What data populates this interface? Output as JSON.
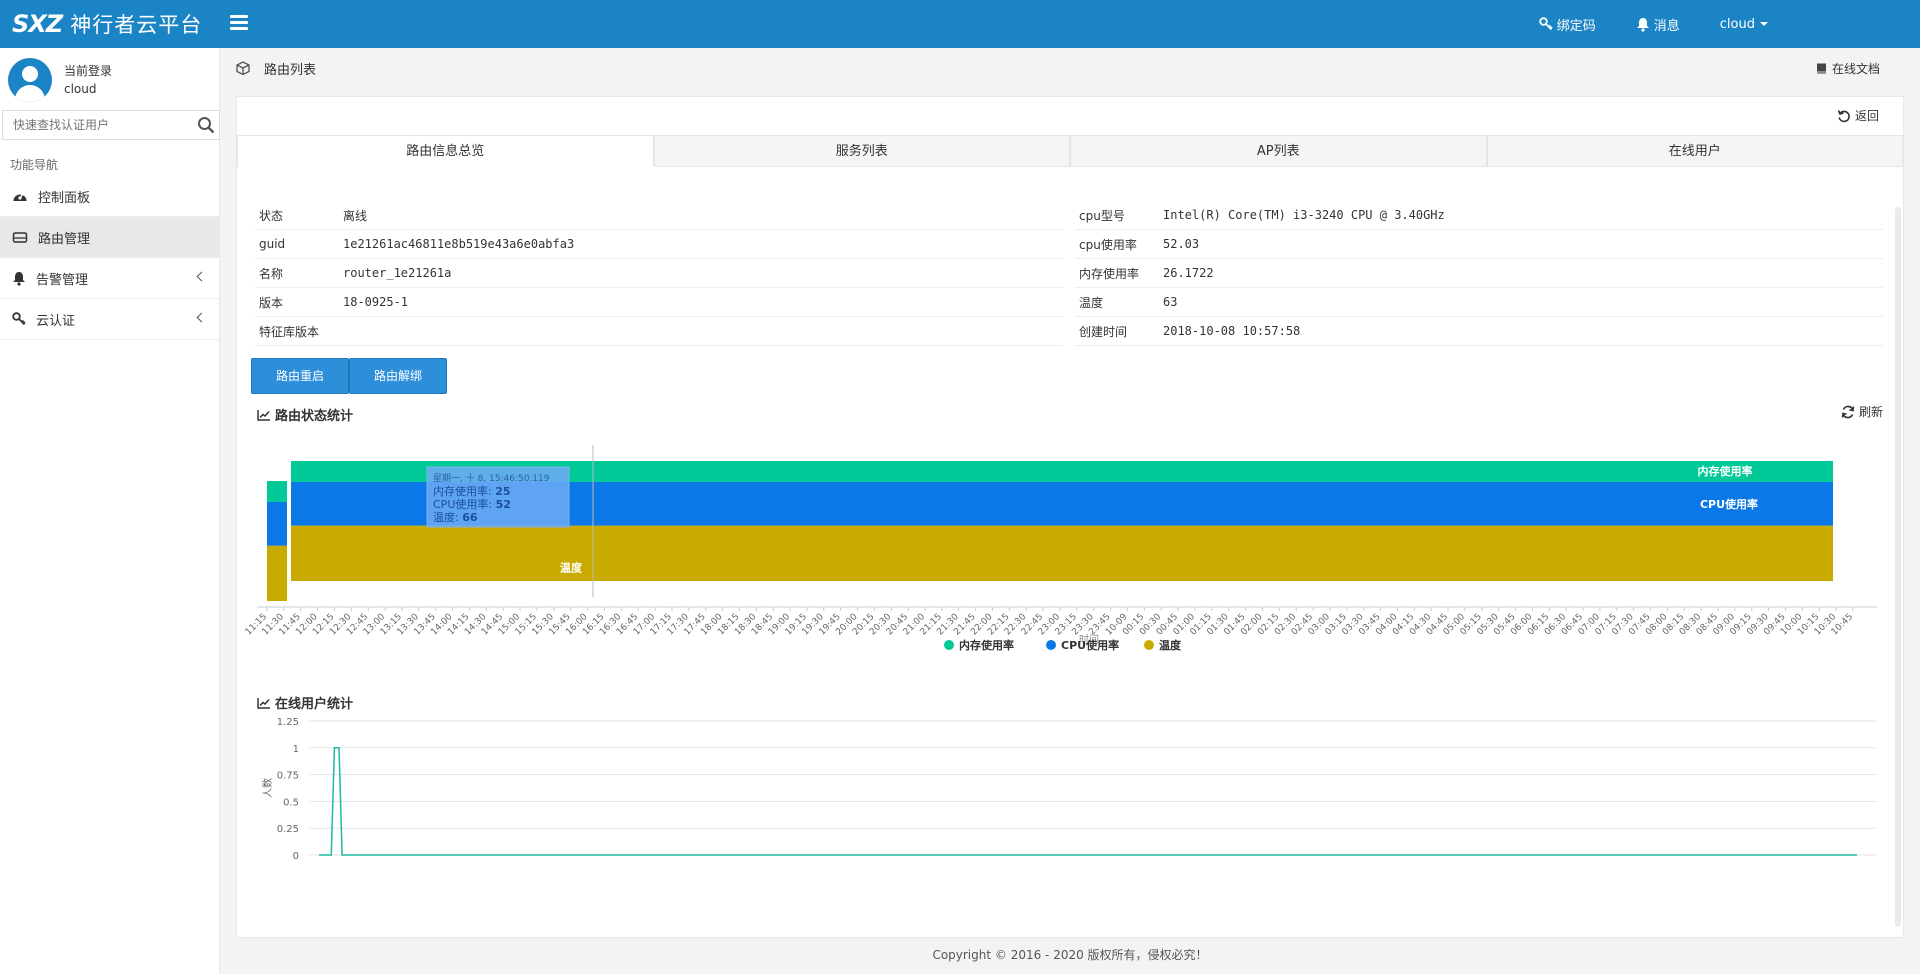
{
  "header": {
    "logo_mark": "SXZ",
    "logo_text": "神行者云平台",
    "bind_code": "绑定码",
    "messages": "消息",
    "user": "cloud"
  },
  "sidebar": {
    "login_label": "当前登录",
    "username": "cloud",
    "search_placeholder": "快速查找认证用户",
    "nav_header": "功能导航",
    "items": [
      {
        "label": "控制面板",
        "icon": "dashboard-icon"
      },
      {
        "label": "路由管理",
        "icon": "router-icon",
        "active": true
      },
      {
        "label": "告警管理",
        "icon": "bell-icon"
      },
      {
        "label": "云认证",
        "icon": "key-icon"
      }
    ]
  },
  "breadcrumb": {
    "title": "路由列表",
    "doc_link": "在线文档"
  },
  "panel": {
    "back_label": "返回",
    "tabs": [
      "路由信息总览",
      "服务列表",
      "AP列表",
      "在线用户"
    ],
    "info_left": [
      {
        "key": "状态",
        "value": "离线"
      },
      {
        "key": "guid",
        "value": "1e21261ac46811e8b519e43a6e0abfa3"
      },
      {
        "key": "名称",
        "value": "router_1e21261a"
      },
      {
        "key": "版本",
        "value": "18-0925-1"
      },
      {
        "key": "特征库版本",
        "value": ""
      }
    ],
    "info_right": [
      {
        "key": "cpu型号",
        "value": "Intel(R) Core(TM) i3-3240 CPU @ 3.40GHz"
      },
      {
        "key": "cpu使用率",
        "value": "52.03"
      },
      {
        "key": "内存使用率",
        "value": "26.1722"
      },
      {
        "key": "温度",
        "value": "63"
      },
      {
        "key": "创建时间",
        "value": "2018-10-08 10:57:58"
      }
    ],
    "restart_button": "路由重启",
    "unbind_button": "路由解绑",
    "status_title": "路由状态统计",
    "refresh_label": "刷新",
    "users_title": "在线用户统计"
  },
  "chart_data": [
    {
      "type": "area",
      "title": "路由状态统计",
      "stacked": true,
      "categories": [
        "11:15",
        "11:30",
        "11:45",
        "12:00",
        "12:15",
        "12:30",
        "12:45",
        "13:00",
        "13:15",
        "13:30",
        "13:45",
        "14:00",
        "14:15",
        "14:30",
        "14:45",
        "15:00",
        "15:15",
        "15:30",
        "15:45",
        "16:00",
        "16:15",
        "16:30",
        "16:45",
        "17:00",
        "17:15",
        "17:30",
        "17:45",
        "18:00",
        "18:15",
        "18:30",
        "18:45",
        "19:00",
        "19:15",
        "19:30",
        "19:45",
        "20:00",
        "20:15",
        "20:30",
        "20:45",
        "21:00",
        "21:15",
        "21:30",
        "21:45",
        "22:00",
        "22:15",
        "22:30",
        "22:45",
        "23:00",
        "23:15",
        "23:30",
        "23:45",
        "10-09",
        "00:15",
        "00:30",
        "00:45",
        "01:00",
        "01:15",
        "01:30",
        "01:45",
        "02:00",
        "02:15",
        "02:30",
        "02:45",
        "03:00",
        "03:15",
        "03:30",
        "03:45",
        "04:00",
        "04:15",
        "04:30",
        "04:45",
        "05:00",
        "05:15",
        "05:30",
        "05:45",
        "06:00",
        "06:15",
        "06:30",
        "06:45",
        "07:00",
        "07:15",
        "07:30",
        "07:45",
        "08:00",
        "08:15",
        "08:30",
        "08:45",
        "09:00",
        "09:15",
        "09:30",
        "09:45",
        "10:00",
        "10:15",
        "10:30",
        "10:45"
      ],
      "series": [
        {
          "name": "温度",
          "color": "#c9ab00",
          "value": 66
        },
        {
          "name": "CPU使用率",
          "color": "#0a78e6",
          "value": 52
        },
        {
          "name": "内存使用率",
          "color": "#00c997",
          "value": 25
        }
      ],
      "tooltip": {
        "time": "星期一, 十 8, 15:46:50.119",
        "lines": [
          {
            "label": "内存使用率: ",
            "value": "25"
          },
          {
            "label": "CPU使用率: ",
            "value": "52"
          },
          {
            "label": "温度: ",
            "value": "66"
          }
        ]
      },
      "xlabel": "时间",
      "legend": "bottom-center",
      "grid": false
    },
    {
      "type": "line",
      "title": "在线用户统计",
      "ylabel": "人数",
      "ylim": [
        0,
        1.25
      ],
      "yticks": [
        "0",
        "0.25",
        "0.5",
        "0.75",
        "1",
        "1.25"
      ],
      "color": "#1fb8a0",
      "points": [
        [
          0.0,
          0
        ],
        [
          0.008,
          0
        ],
        [
          0.01,
          1
        ],
        [
          0.013,
          1
        ],
        [
          0.015,
          0
        ],
        [
          1.0,
          0
        ]
      ],
      "grid": true
    }
  ],
  "footer": "Copyright © 2016 - 2020 版权所有，侵权必究！"
}
